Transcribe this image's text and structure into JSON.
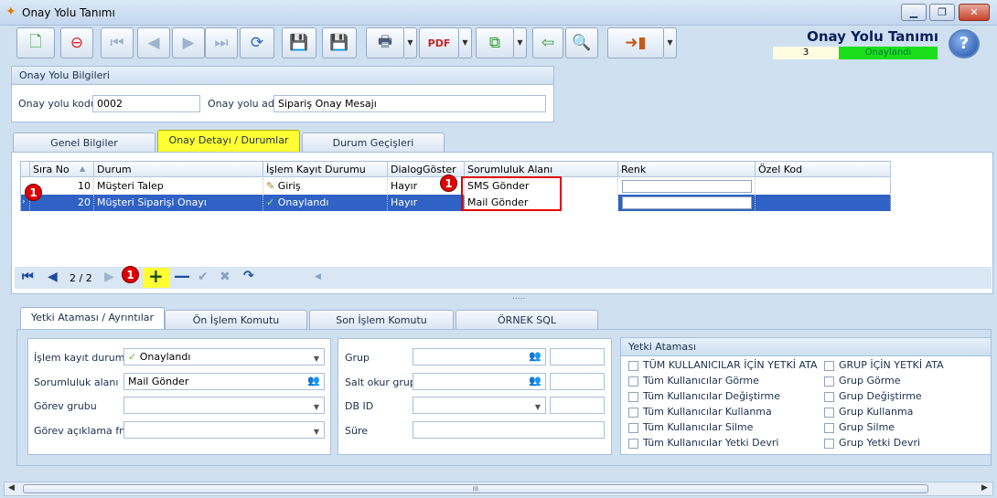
{
  "window": {
    "title": "Onay Yolu Tanımı",
    "icon": "butterfly-icon",
    "controls": [
      "minimize-icon",
      "restore-icon",
      "close-icon"
    ]
  },
  "toolbar": {
    "icons": [
      "new-document-icon",
      "delete-document-icon",
      "first-record-icon",
      "previous-record-icon",
      "next-record-icon",
      "last-record-icon",
      "refresh-icon",
      "save-icon",
      "cancel-save-icon",
      "print-icon",
      "export-pdf-icon",
      "copy-icon",
      "import-icon",
      "search-document-icon",
      "exit-door-icon"
    ]
  },
  "header": {
    "title": "Onay Yolu Tanımı",
    "record_number": "3",
    "status": "Onaylandı",
    "status_color": "#1adf1a",
    "help_icon": "help-icon"
  },
  "info_group": {
    "heading": "Onay Yolu Bilgileri",
    "code_label": "Onay yolu kodu",
    "code_value": "0002",
    "name_label": "Onay yolu adı",
    "name_value": "Sipariş Onay Mesajı"
  },
  "main_tabs": [
    {
      "label": "Genel Bilgiler"
    },
    {
      "label": "Onay Detayı / Durumlar",
      "active": true
    },
    {
      "label": "Durum Geçişleri"
    }
  ],
  "grid": {
    "columns": [
      "Sıra No",
      "Durum",
      "İşlem Kayıt Durumu",
      "DialogGöster",
      "Sorumluluk Alanı",
      "Renk",
      "Özel Kod"
    ],
    "rows": [
      {
        "sira": "10",
        "durum": "Müşteri Talep",
        "islem": "Giriş",
        "islem_icon": "pencil-icon",
        "dialog": "Hayır",
        "sorumluluk": "SMS Gönder",
        "renk": "",
        "ozel": ""
      },
      {
        "sira": "20",
        "durum": "Müşteri Siparişi Onayı",
        "islem": "Onaylandı",
        "islem_icon": "check-icon",
        "dialog": "Hayır",
        "sorumluluk": "Mail Gönder",
        "renk": "",
        "ozel": ""
      }
    ],
    "selected_row": 1,
    "highlight_color": "#e00000",
    "badge": "1"
  },
  "navigator": {
    "position": "2 / 2",
    "icons": [
      "first-icon",
      "prev-icon",
      "next-icon",
      "add-icon",
      "remove-icon",
      "confirm-icon",
      "cancel-icon",
      "redo-icon"
    ]
  },
  "splitter": ".....",
  "bottom_tabs": [
    {
      "label": "Yetki Ataması / Ayrıntılar",
      "active": true
    },
    {
      "label": "Ön İşlem Komutu"
    },
    {
      "label": "Son İşlem Komutu"
    },
    {
      "label": "ÖRNEK SQL"
    }
  ],
  "details": {
    "islem_label": "İşlem kayıt durumu",
    "islem_value": "Onaylandı",
    "sorumluluk_label": "Sorumluluk alanı",
    "sorumluluk_value": "Mail Gönder",
    "gorev_label": "Görev grubu",
    "gorev_value": "",
    "aciklama_label": "Görev açıklama fmt",
    "aciklama_value": ""
  },
  "details2": {
    "grup_label": "Grup",
    "salt_label": "Salt okur grup",
    "db_label": "DB ID",
    "sure_label": "Süre"
  },
  "yetki": {
    "heading": "Yetki Ataması",
    "left": [
      "TÜM KULLANICILAR İÇİN YETKİ ATA",
      "Tüm Kullanıcılar Görme",
      "Tüm Kullanıcılar Değiştirme",
      "Tüm Kullanıcılar Kullanma",
      "Tüm Kullanıcılar Silme",
      "Tüm Kullanıcılar Yetki Devri"
    ],
    "right": [
      "GRUP İÇİN YETKİ ATA",
      "Grup Görme",
      "Grup Değiştirme",
      "Grup Kullanma",
      "Grup Silme",
      "Grup Yetki Devri"
    ]
  },
  "scrollbar": {
    "thumb": "III"
  }
}
